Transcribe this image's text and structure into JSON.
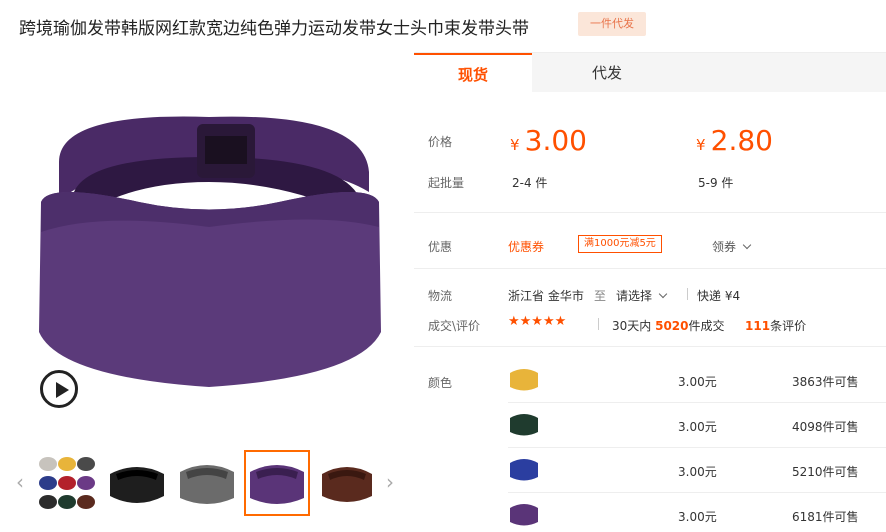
{
  "product": {
    "title": "跨境瑜伽发带韩版网红款宽边纯色弹力运动发带女士头巾束发带头带",
    "badge": "一件代发"
  },
  "gallery": {
    "main_image_icon": "purple-headband-photo",
    "thumbnails": [
      {
        "name": "multicolor",
        "colors": [
          "#c7c3bd",
          "#e8b43a",
          "#2c3c8a",
          "#b3212b",
          "#6b3a86",
          "#2c2c2c"
        ]
      },
      {
        "name": "black",
        "color": "#1e1e1e"
      },
      {
        "name": "gray",
        "color": "#6b6b6b"
      },
      {
        "name": "purple",
        "color": "#5a3478"
      },
      {
        "name": "brown",
        "color": "#5a2a1e"
      }
    ]
  },
  "tabs": [
    {
      "label": "现货"
    },
    {
      "label": "代发"
    }
  ],
  "pricing": {
    "price_label": "价格",
    "currency": "¥",
    "tiers": [
      {
        "price": "3.00",
        "qty": "2-4 件"
      },
      {
        "price": "2.80",
        "qty": "5-9 件"
      }
    ],
    "moq_label": "起批量"
  },
  "promo": {
    "label": "优惠",
    "coupon_link": "优惠券",
    "coupon_tag": "满1000元减5元",
    "claim": "领券"
  },
  "logistics": {
    "label": "物流",
    "from": "浙江省 金华市",
    "to_word": "至",
    "select": "请选择",
    "express": "快递 ¥4"
  },
  "deals": {
    "label": "成交\\评价",
    "stars": "★★★★★",
    "days_prefix": "30天内",
    "deal_count": "5020",
    "deal_suffix": "件成交",
    "review_count": "111",
    "review_suffix": "条评价"
  },
  "colors": {
    "label": "颜色",
    "items": [
      {
        "swatch": "#e8b43a",
        "price": "3.00元",
        "stock": "3863件可售"
      },
      {
        "swatch": "#1f3b2e",
        "price": "3.00元",
        "stock": "4098件可售"
      },
      {
        "swatch": "#2b3ea0",
        "price": "3.00元",
        "stock": "5210件可售"
      },
      {
        "swatch": "#5a3478",
        "price": "3.00元",
        "stock": "6181件可售"
      }
    ]
  }
}
